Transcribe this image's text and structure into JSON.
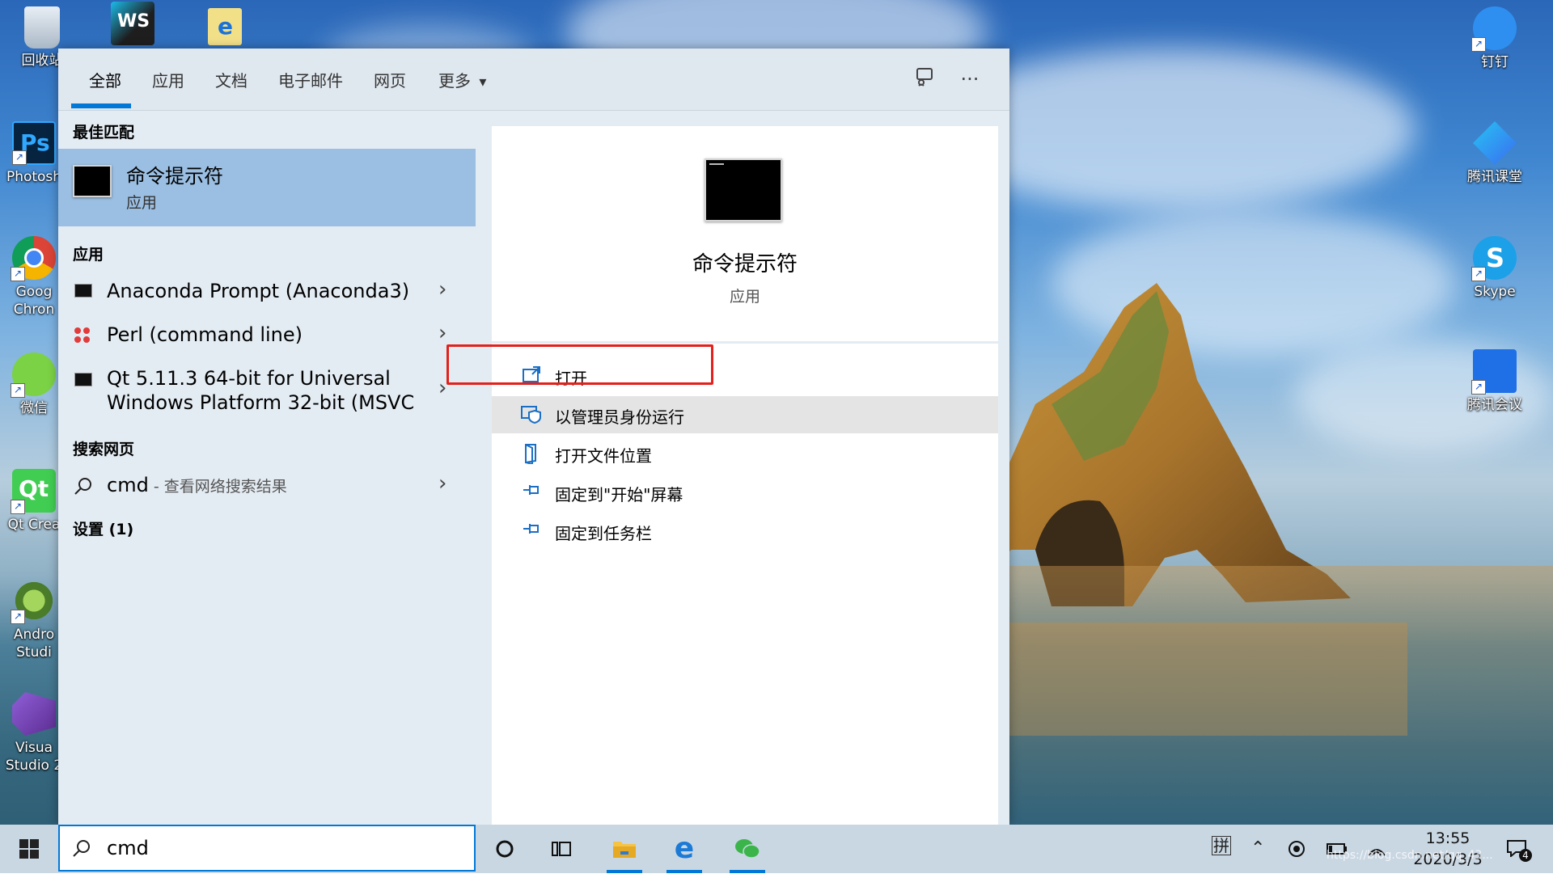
{
  "desktop": {
    "left_icons": [
      {
        "label": "回收站",
        "icon": "recycle-bin-icon"
      },
      {
        "label": "WS",
        "icon": "webstorm-icon"
      },
      {
        "label": "e",
        "icon": "ie-icon"
      },
      {
        "label": "Photosh",
        "icon": "photoshop-icon",
        "badge": "Ps"
      },
      {
        "label": "Goog\nChron",
        "icon": "chrome-icon"
      },
      {
        "label": "微信",
        "icon": "wechat-icon"
      },
      {
        "label": "Qt Crea",
        "icon": "qt-creator-icon",
        "badge": "Qt"
      },
      {
        "label": "Andro\nStudi",
        "icon": "android-studio-icon"
      },
      {
        "label": "Visua\nStudio 2",
        "icon": "visual-studio-icon"
      }
    ],
    "right_icons": [
      {
        "label": "钉钉",
        "icon": "dingtalk-icon"
      },
      {
        "label": "腾讯课堂",
        "icon": "tencent-classroom-icon"
      },
      {
        "label": "Skype",
        "icon": "skype-icon",
        "badge": "S"
      },
      {
        "label": "腾讯会议",
        "icon": "tencent-meeting-icon"
      }
    ]
  },
  "search_panel": {
    "tabs": [
      "全部",
      "应用",
      "文档",
      "电子邮件",
      "网页",
      "更多"
    ],
    "more_chevron": "▾",
    "feedback_icon": "feedback-icon",
    "options_label": "···",
    "best_match_heading": "最佳匹配",
    "best_match": {
      "title": "命令提示符",
      "subtitle": "应用"
    },
    "apps_heading": "应用",
    "apps": [
      {
        "name": "Anaconda Prompt (Anaconda3)",
        "icon": "console-icon"
      },
      {
        "name": "Perl (command line)",
        "icon": "perl-icon"
      },
      {
        "name": "Qt 5.11.3 64-bit for Universal\nWindows Platform 32-bit (MSVC",
        "icon": "console-icon"
      }
    ],
    "web_heading": "搜索网页",
    "web_query": "cmd",
    "web_hint": " - 查看网络搜索结果",
    "settings_heading": "设置 (1)",
    "detail": {
      "title": "命令提示符",
      "subtitle": "应用",
      "actions": [
        {
          "label": "打开",
          "icon": "open-window-icon"
        },
        {
          "label": "以管理员身份运行",
          "icon": "shield-icon"
        },
        {
          "label": "打开文件位置",
          "icon": "file-location-icon"
        },
        {
          "label": "固定到\"开始\"屏幕",
          "icon": "pin-icon"
        },
        {
          "label": "固定到任务栏",
          "icon": "pin-icon"
        }
      ]
    }
  },
  "taskbar": {
    "search_value": "cmd",
    "ime_label": "拼",
    "time": "13:55",
    "date": "2020/3/3",
    "notification_count": "4"
  },
  "watermark": "https://blog.csdn.net/qq_43..."
}
